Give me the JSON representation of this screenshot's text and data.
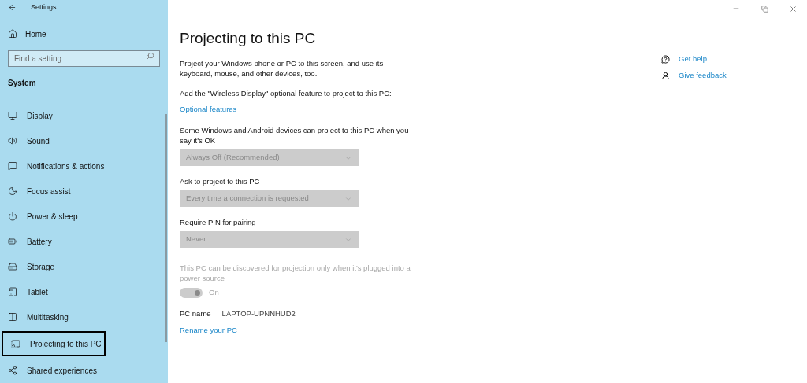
{
  "window": {
    "title": "Settings"
  },
  "sidebar": {
    "home": "Home",
    "search": {
      "placeholder": "Find a setting"
    },
    "section": "System",
    "items": [
      {
        "label": "Display",
        "selected": false
      },
      {
        "label": "Sound",
        "selected": false
      },
      {
        "label": "Notifications & actions",
        "selected": false
      },
      {
        "label": "Focus assist",
        "selected": false
      },
      {
        "label": "Power & sleep",
        "selected": false
      },
      {
        "label": "Battery",
        "selected": false
      },
      {
        "label": "Storage",
        "selected": false
      },
      {
        "label": "Tablet",
        "selected": false
      },
      {
        "label": "Multitasking",
        "selected": false
      },
      {
        "label": "Projecting to this PC",
        "selected": true
      },
      {
        "label": "Shared experiences",
        "selected": false
      }
    ]
  },
  "page": {
    "title": "Projecting to this PC",
    "intro": "Project your Windows phone or PC to this screen, and use its keyboard, mouse, and other devices, too.",
    "feature_note": "Add the \"Wireless Display\" optional feature to project to this PC:",
    "feature_link": "Optional features",
    "dropdowns": [
      {
        "label": "Some Windows and Android devices can project to this PC when you say it's OK",
        "value": "Always Off (Recommended)",
        "disabled": true
      },
      {
        "label": "Ask to project to this PC",
        "value": "Every time a connection is requested",
        "disabled": true
      },
      {
        "label": "Require PIN for pairing",
        "value": "Never",
        "disabled": true
      }
    ],
    "power_note": "This PC can be discovered for projection only when it's plugged into a power source",
    "toggle": {
      "on": true,
      "disabled": true,
      "label": "On"
    },
    "pc_name_label": "PC name",
    "pc_name": "LAPTOP-UPNNHUD2",
    "rename_link": "Rename your PC"
  },
  "help": [
    {
      "label": "Get help"
    },
    {
      "label": "Give feedback"
    }
  ]
}
